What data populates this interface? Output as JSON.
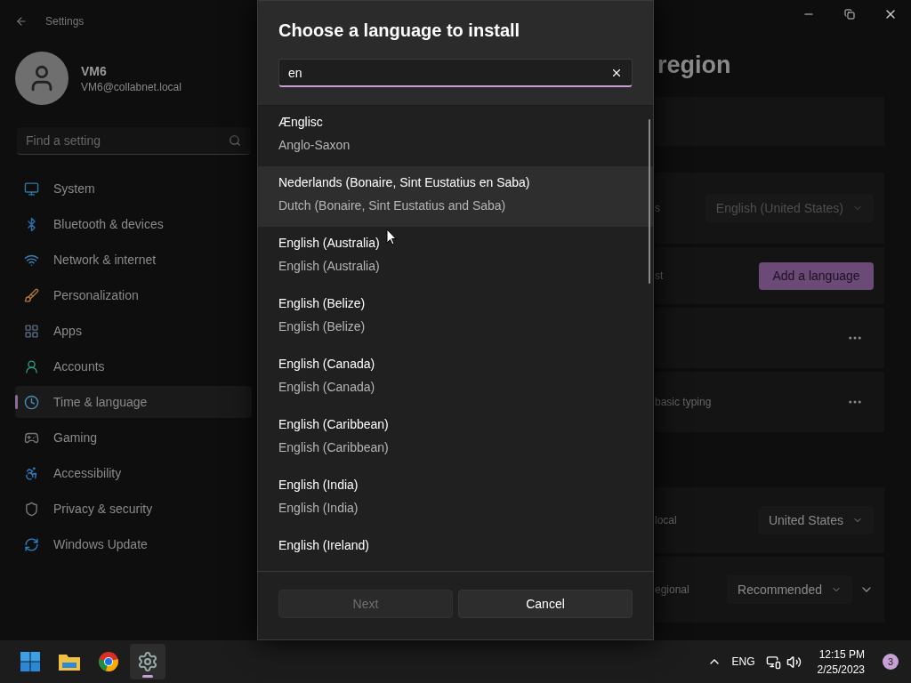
{
  "window": {
    "title": "Settings"
  },
  "account": {
    "name": "VM6",
    "email": "VM6@collabnet.local"
  },
  "search": {
    "placeholder": "Find a setting"
  },
  "nav": [
    {
      "label": "System",
      "kind": "system",
      "selected": false
    },
    {
      "label": "Bluetooth & devices",
      "kind": "bluetooth",
      "selected": false
    },
    {
      "label": "Network & internet",
      "kind": "network",
      "selected": false
    },
    {
      "label": "Personalization",
      "kind": "brush",
      "selected": false
    },
    {
      "label": "Apps",
      "kind": "apps",
      "selected": false
    },
    {
      "label": "Accounts",
      "kind": "accounts",
      "selected": false
    },
    {
      "label": "Time & language",
      "kind": "time",
      "selected": true
    },
    {
      "label": "Gaming",
      "kind": "gaming",
      "selected": false
    },
    {
      "label": "Accessibility",
      "kind": "accessibility",
      "selected": false
    },
    {
      "label": "Privacy & security",
      "kind": "privacy",
      "selected": false
    },
    {
      "label": "Windows Update",
      "kind": "update",
      "selected": false
    }
  ],
  "page": {
    "title": "region",
    "sections": [
      {
        "cards": [
          {
            "kind": "blank"
          },
          {
            "kind": "dropdown",
            "label": "s",
            "value": "English (United States)",
            "disabled": true
          },
          {
            "kind": "button",
            "label": "st",
            "action": "Add a language"
          },
          {
            "kind": "more"
          },
          {
            "kind": "more",
            "label": "basic typing"
          }
        ]
      },
      {
        "cards": [
          {
            "kind": "dropdown",
            "label": "local",
            "value": "United States",
            "disabled": false
          },
          {
            "kind": "dropdown",
            "label": "egional",
            "value": "Recommended",
            "disabled": false,
            "expandable": true
          }
        ]
      }
    ]
  },
  "dialog": {
    "title": "Choose a language to install",
    "search": {
      "value": "en"
    },
    "items": [
      {
        "title": "Ænglisc",
        "subtitle": "Anglo-Saxon",
        "hovered": false
      },
      {
        "title": "Nederlands (Bonaire, Sint Eustatius en Saba)",
        "subtitle": "Dutch (Bonaire, Sint Eustatius and Saba)",
        "hovered": true
      },
      {
        "title": "English (Australia)",
        "subtitle": "English (Australia)",
        "hovered": false
      },
      {
        "title": "English (Belize)",
        "subtitle": "English (Belize)",
        "hovered": false
      },
      {
        "title": "English (Canada)",
        "subtitle": "English (Canada)",
        "hovered": false
      },
      {
        "title": "English (Caribbean)",
        "subtitle": "English (Caribbean)",
        "hovered": false
      },
      {
        "title": "English (India)",
        "subtitle": "English (India)",
        "hovered": false
      },
      {
        "title": "English (Ireland)",
        "hovered": false
      }
    ],
    "buttons": [
      {
        "label": "Next",
        "disabled": true
      },
      {
        "label": "Cancel",
        "disabled": false
      }
    ]
  },
  "taskbar": {
    "apps": [
      {
        "kind": "start",
        "selected": false
      },
      {
        "kind": "files",
        "selected": false
      },
      {
        "kind": "browser",
        "selected": false
      },
      {
        "kind": "settings",
        "selected": true
      }
    ],
    "language": "ENG",
    "time": "12:15 PM",
    "date": "2/25/2023",
    "badge": "3"
  }
}
